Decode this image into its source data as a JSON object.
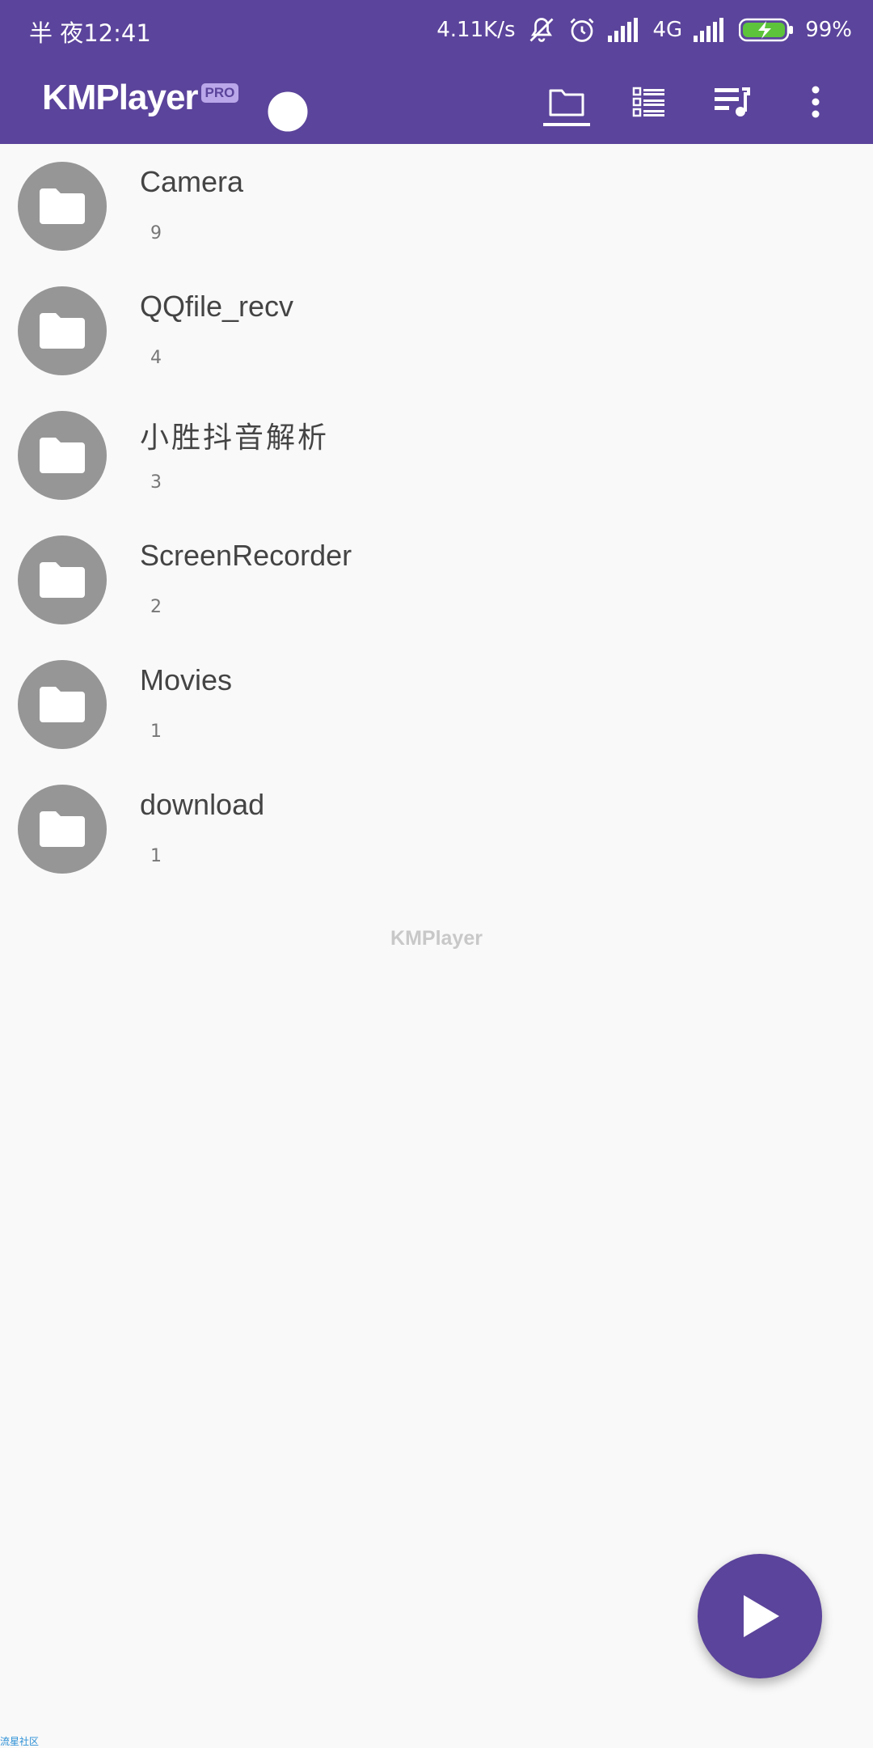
{
  "status_bar": {
    "time": "半 夜12:41",
    "net_speed": "4.11K/s",
    "network_type": "4G",
    "battery": "99%",
    "icons": [
      "mute-icon",
      "alarm-icon",
      "signal-icon",
      "signal-icon",
      "battery-charging-icon"
    ]
  },
  "app_bar": {
    "logo": "KMPlayer",
    "badge": "PRO",
    "icons": [
      "theme-toggle-icon",
      "folder-icon",
      "list-icon",
      "playlist-icon",
      "more-vert-icon"
    ],
    "active_tab": "folder"
  },
  "folders": [
    {
      "name": "Camera",
      "count": "9"
    },
    {
      "name": "QQfile_recv",
      "count": "4"
    },
    {
      "name": "小胜抖音解析",
      "count": "3"
    },
    {
      "name": "ScreenRecorder",
      "count": "2"
    },
    {
      "name": "Movies",
      "count": "1"
    },
    {
      "name": "download",
      "count": "1"
    }
  ],
  "footer": {
    "logo": "KMPlayer"
  },
  "fab": {
    "icon": "play-icon"
  },
  "watermark": "流星社区",
  "colors": {
    "primary": "#5b449b",
    "avatar": "#969696",
    "background": "#f9f9f9"
  }
}
